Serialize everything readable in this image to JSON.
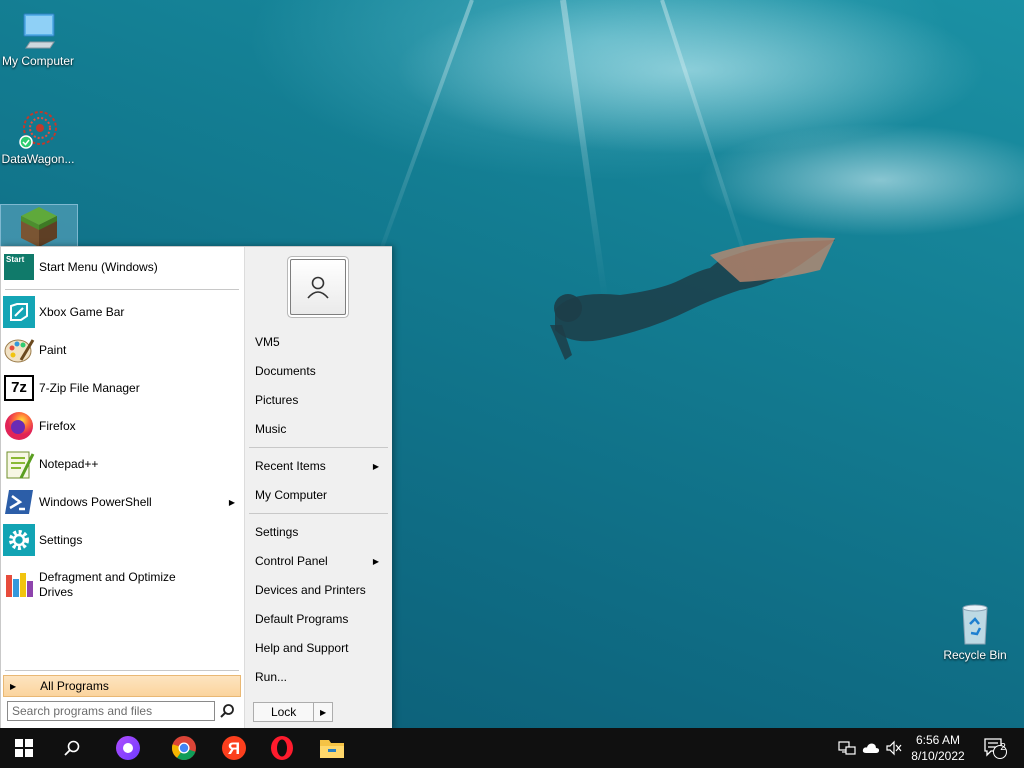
{
  "desktop": {
    "icons": [
      {
        "label": "My Computer",
        "icon": "monitor-icon"
      },
      {
        "label": "DataWagon...",
        "icon": "datawagon-icon"
      },
      {
        "label": "",
        "icon": "minecraft-icon"
      },
      {
        "label": "Recycle Bin",
        "icon": "recycle-bin-icon"
      }
    ]
  },
  "start_menu": {
    "pinned": {
      "label": "Start Menu (Windows)",
      "icon": "start-menu-icon",
      "icon_text": "Start"
    },
    "programs": [
      {
        "label": "Xbox Game Bar",
        "icon": "xbox-game-bar-icon"
      },
      {
        "label": "Paint",
        "icon": "paint-icon"
      },
      {
        "label": "7-Zip File Manager",
        "icon": "7zip-icon",
        "icon_text": "7z"
      },
      {
        "label": "Firefox",
        "icon": "firefox-icon"
      },
      {
        "label": "Notepad++",
        "icon": "notepadpp-icon"
      },
      {
        "label": "Windows PowerShell",
        "icon": "powershell-icon",
        "has_submenu": true
      },
      {
        "label": "Settings",
        "icon": "gear-icon"
      },
      {
        "label": "Defragment and Optimize\nDrives",
        "icon": "defrag-icon"
      }
    ],
    "all_programs": "All Programs",
    "search": {
      "placeholder": "Search programs and files",
      "value": ""
    },
    "right": {
      "user_group": [
        "VM5",
        "Documents",
        "Pictures",
        "Music"
      ],
      "recent": "Recent Items",
      "my_computer": "My Computer",
      "settings": "Settings",
      "control_panel": "Control Panel",
      "devices": "Devices and Printers",
      "default_programs": "Default Programs",
      "help": "Help and Support",
      "run": "Run...",
      "lock": "Lock"
    }
  },
  "taskbar": {
    "apps": [
      "windows-start-icon",
      "search-icon",
      "alice-icon",
      "chrome-icon",
      "yandex-icon",
      "opera-icon",
      "file-explorer-icon"
    ],
    "clock_time": "6:56 AM",
    "clock_date": "8/10/2022",
    "notification_count": "2"
  },
  "colors": {
    "accent": "#0078d7",
    "all_programs_bg": "#fbd49d",
    "taskbar_bg": "#101010"
  }
}
